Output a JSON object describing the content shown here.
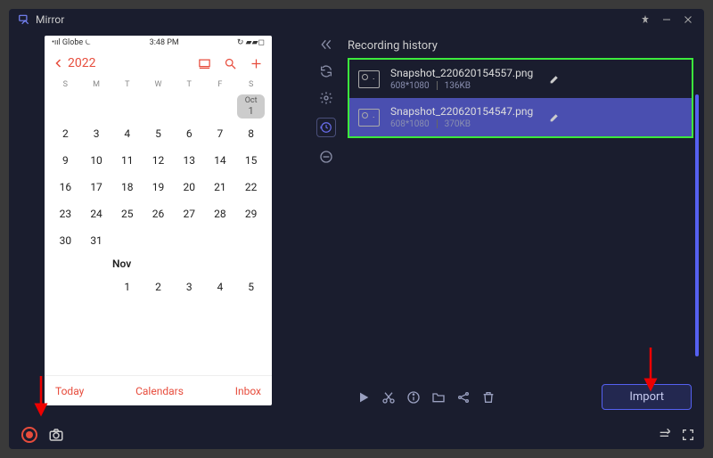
{
  "titlebar": {
    "app_name": "Mirror"
  },
  "phone": {
    "status": {
      "carrier": "Globe",
      "time": "3:48 PM"
    },
    "header": {
      "year": "2022"
    },
    "weekdays": [
      "S",
      "M",
      "T",
      "W",
      "T",
      "F",
      "S"
    ],
    "oct_badge": {
      "label": "Oct",
      "num": "1"
    },
    "oct_row1": [
      "2",
      "3",
      "4",
      "5",
      "6",
      "7",
      "8"
    ],
    "oct_row2": [
      "9",
      "10",
      "11",
      "12",
      "13",
      "14",
      "15"
    ],
    "oct_row3": [
      "16",
      "17",
      "18",
      "19",
      "20",
      "21",
      "22"
    ],
    "oct_row4": [
      "23",
      "24",
      "25",
      "26",
      "27",
      "28",
      "29"
    ],
    "oct_row5": [
      "30",
      "31",
      "",
      "",
      "",
      "",
      ""
    ],
    "nov_label": "Nov",
    "nov_row1": [
      "",
      "",
      "1",
      "2",
      "3",
      "4",
      "5"
    ],
    "footer": {
      "today": "Today",
      "calendars": "Calendars",
      "inbox": "Inbox"
    }
  },
  "panel": {
    "title": "Recording history",
    "items": [
      {
        "name": "Snapshot_220620154557.png",
        "res": "608*1080",
        "size": "136KB"
      },
      {
        "name": "Snapshot_220620154547.png",
        "res": "608*1080",
        "size": "370KB"
      }
    ],
    "import_label": "Import"
  }
}
